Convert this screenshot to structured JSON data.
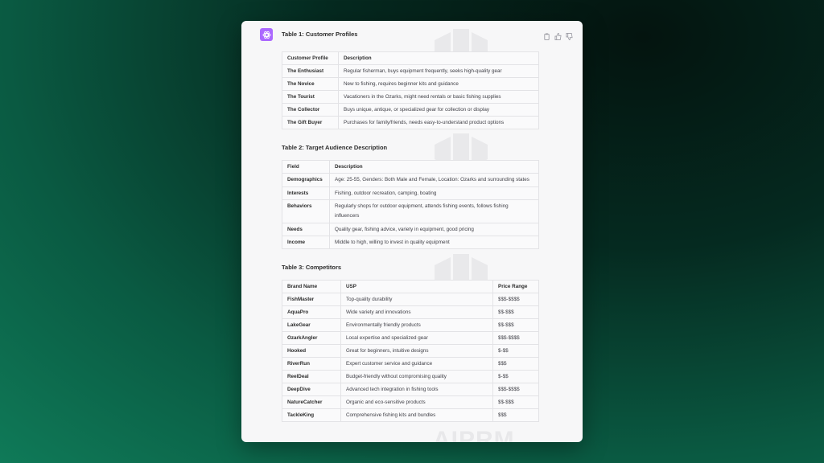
{
  "header": {
    "title": "Table 1: Customer Profiles"
  },
  "watermark": {
    "text": "AIPRM"
  },
  "table1": {
    "headers": [
      "Customer Profile",
      "Description"
    ],
    "rows": [
      [
        "The Enthusiast",
        "Regular fisherman, buys equipment frequently, seeks high-quality gear"
      ],
      [
        "The Novice",
        "New to fishing, requires beginner kits and guidance"
      ],
      [
        "The Tourist",
        "Vacationers in the Ozarks, might need rentals or basic fishing supplies"
      ],
      [
        "The Collector",
        "Buys unique, antique, or specialized gear for collection or display"
      ],
      [
        "The Gift Buyer",
        "Purchases for family/friends, needs easy-to-understand product options"
      ]
    ]
  },
  "table2": {
    "title": "Table 2: Target Audience Description",
    "headers": [
      "Field",
      "Description"
    ],
    "rows": [
      [
        "Demographics",
        "Age: 25-55, Genders: Both Male and Female, Location: Ozarks and surrounding states"
      ],
      [
        "Interests",
        "Fishing, outdoor recreation, camping, boating"
      ],
      [
        "Behaviors",
        "Regularly shops for outdoor equipment, attends fishing events, follows fishing influencers"
      ],
      [
        "Needs",
        "Quality gear, fishing advice, variety in equipment, good pricing"
      ],
      [
        "Income",
        "Middle to high, willing to invest in quality equipment"
      ]
    ]
  },
  "table3": {
    "title": "Table 3: Competitors",
    "headers": [
      "Brand Name",
      "USP",
      "Price Range"
    ],
    "rows": [
      [
        "FishMaster",
        "Top-quality durability",
        "$$$-$$$$"
      ],
      [
        "AquaPro",
        "Wide variety and innovations",
        "$$-$$$"
      ],
      [
        "LakeGear",
        "Environmentally friendly products",
        "$$-$$$"
      ],
      [
        "OzarkAngler",
        "Local expertise and specialized gear",
        "$$$-$$$$"
      ],
      [
        "Hooked",
        "Great for beginners, intuitive designs",
        "$-$$"
      ],
      [
        "RiverRun",
        "Expert customer service and guidance",
        "$$$"
      ],
      [
        "ReelDeal",
        "Budget-friendly without compromising quality",
        "$-$$"
      ],
      [
        "DeepDive",
        "Advanced tech integration in fishing tools",
        "$$$-$$$$"
      ],
      [
        "NatureCatcher",
        "Organic and eco-sensitive products",
        "$$-$$$"
      ],
      [
        "TackleKing",
        "Comprehensive fishing kits and bundles",
        "$$$"
      ]
    ]
  },
  "colors": {
    "avatar": "#ab68ff",
    "background_dark": "#04140f",
    "background_light": "#0f7a58"
  },
  "icons": {
    "avatar": "openai-logo-icon",
    "copy": "clipboard-icon",
    "like": "thumbs-up-icon",
    "dislike": "thumbs-down-icon"
  }
}
